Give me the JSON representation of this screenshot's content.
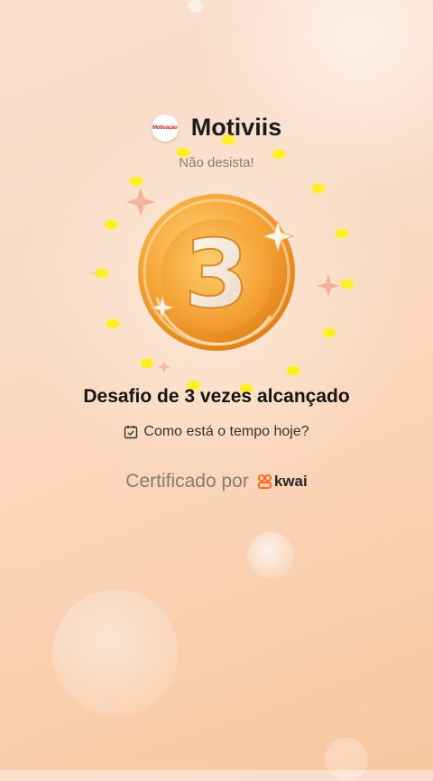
{
  "brand": {
    "logo_text": "Motivação",
    "name": "Motiviis",
    "tagline": "Não desista!"
  },
  "badge": {
    "number": "3",
    "colors": {
      "gold_light": "#ffd277",
      "gold_mid": "#f5a536",
      "gold_dark": "#e07d18",
      "dot": "#ffee22"
    }
  },
  "achievement": {
    "title": "Desafio de 3 vezes alcançado",
    "question": "Como está o tempo hoje?"
  },
  "certification": {
    "label": "Certificado por",
    "provider": "kwai"
  },
  "icons": [
    "calendar-check-icon",
    "kwai-logo-icon",
    "sparkle-icon"
  ]
}
